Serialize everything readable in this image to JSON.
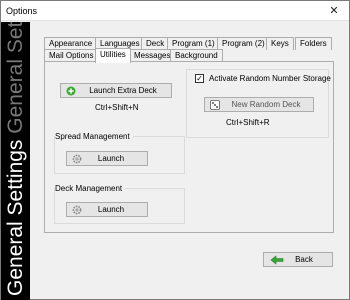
{
  "window": {
    "title": "Options",
    "close_glyph": "✕"
  },
  "sidebar": {
    "caption": "General Settings",
    "ghost": "General Setting"
  },
  "tabs": {
    "row1": [
      "Appearance",
      "Languages",
      "Deck",
      "Program (1)",
      "Program (2)",
      "Keys",
      "Folders"
    ],
    "row2": [
      "Mail Options",
      "Utilities",
      "Messages",
      "Background"
    ],
    "active": "Utilities"
  },
  "utilities": {
    "extra_deck": {
      "button": "Launch Extra Deck",
      "shortcut": "Ctrl+Shift+N"
    },
    "random": {
      "checkbox_label": "Activate Random Number Storage",
      "checked": true,
      "button": "New Random Deck",
      "shortcut": "Ctrl+Shift+R"
    },
    "spread": {
      "title": "Spread Management",
      "button": "Launch"
    },
    "deck": {
      "title": "Deck Management",
      "button": "Launch"
    }
  },
  "footer": {
    "back": "Back"
  },
  "colors": {
    "sidebar_bg": "#000000",
    "accent_green": "#3aa832"
  }
}
